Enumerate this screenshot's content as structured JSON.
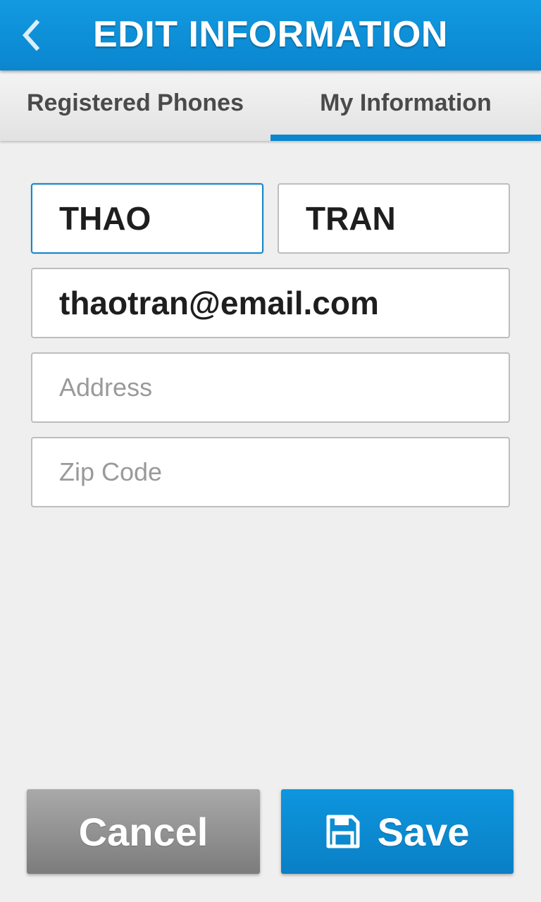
{
  "header": {
    "title": "EDIT INFORMATION",
    "back_icon": "chevron-left-icon"
  },
  "tabs": [
    {
      "label": "Registered Phones",
      "active": false
    },
    {
      "label": "My Information",
      "active": true
    }
  ],
  "form": {
    "first_name": {
      "value": "THAO",
      "placeholder": ""
    },
    "last_name": {
      "value": "TRAN",
      "placeholder": ""
    },
    "email": {
      "value": "thaotran@email.com",
      "placeholder": ""
    },
    "address": {
      "value": "",
      "placeholder": "Address"
    },
    "zip_code": {
      "value": "",
      "placeholder": "Zip Code"
    }
  },
  "actions": {
    "cancel_label": "Cancel",
    "save_label": "Save",
    "save_icon": "floppy-disk-icon"
  },
  "colors": {
    "accent": "#0a86cf",
    "cancel": "#8f8f8f",
    "background": "#efefef"
  }
}
